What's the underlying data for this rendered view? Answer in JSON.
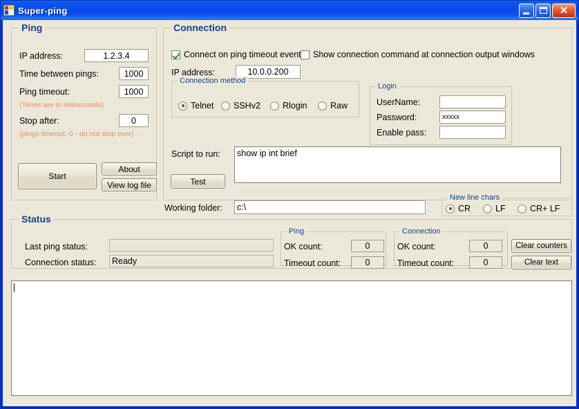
{
  "window": {
    "title": "Super-ping",
    "icon": "app-icon",
    "caption_buttons": [
      {
        "name": "minimize",
        "glyph": "_"
      },
      {
        "name": "maximize",
        "glyph": "□"
      },
      {
        "name": "close",
        "glyph": "✕"
      }
    ]
  },
  "colors": {
    "titlebar_blue": "#0a4cec",
    "client_beige": "#ece8d9",
    "group_header_blue": "#15428b",
    "hint_orange": "#d98f6a",
    "close_red": "#c23010",
    "radio_green": "#1f7a1f"
  },
  "ping_panel": {
    "title": "Ping",
    "ip_label": "IP address:",
    "ip_value": "1.2.3.4",
    "time_between_label": "Time between pings:",
    "time_between_value": "1000",
    "timeout_label": "Ping timeout:",
    "timeout_value": "1000",
    "times_hint": "(Times are in miliseconds)",
    "stop_after_label": "Stop after:",
    "stop_after_value": "0",
    "stop_after_hint": "(pings timeout, 0 - do not stop ever)",
    "start_button": "Start",
    "about_button": "About",
    "view_log_button": "View log file"
  },
  "connection_panel": {
    "title": "Connection",
    "connect_on_timeout_label": "Connect on ping timeout event",
    "connect_on_timeout_checked": true,
    "show_command_label": "Show connection command at connection output windows",
    "show_command_checked": false,
    "ip_label": "IP address:",
    "ip_value": "10.0.0.200",
    "method_group_title": "Connection method",
    "methods": [
      {
        "label": "Telnet",
        "selected": true
      },
      {
        "label": "SSHv2",
        "selected": false
      },
      {
        "label": "Rlogin",
        "selected": false
      },
      {
        "label": "Raw",
        "selected": false
      }
    ],
    "login_group_title": "Login",
    "username_label": "UserName:",
    "username_value": "",
    "password_label": "Password:",
    "password_value": "xxxxx",
    "enable_pass_label": "Enable pass:",
    "enable_pass_value": "",
    "script_label": "Script to run:",
    "script_value": "show ip int brief",
    "test_button": "Test",
    "working_folder_label": "Working folder:",
    "working_folder_value": "c:\\",
    "newline_group_title": "New line chars",
    "newline_options": [
      {
        "label": "CR",
        "selected": true
      },
      {
        "label": "LF",
        "selected": false
      },
      {
        "label": "CR+ LF",
        "selected": false
      }
    ]
  },
  "status_panel": {
    "title": "Status",
    "last_ping_status_label": "Last ping status:",
    "last_ping_status_value": "",
    "connection_status_label": "Connection status:",
    "connection_status_value": "Ready",
    "ping_counters": {
      "group_title": "Ping",
      "ok_label": "OK count:",
      "ok_value": "0",
      "timeout_label": "Timeout count:",
      "timeout_value": "0"
    },
    "connection_counters": {
      "group_title": "Connection",
      "ok_label": "OK count:",
      "ok_value": "0",
      "timeout_label": "Timeout count:",
      "timeout_value": "0"
    },
    "clear_counters_button": "Clear counters",
    "clear_text_button": "Clear text"
  },
  "output": {
    "value": ""
  }
}
